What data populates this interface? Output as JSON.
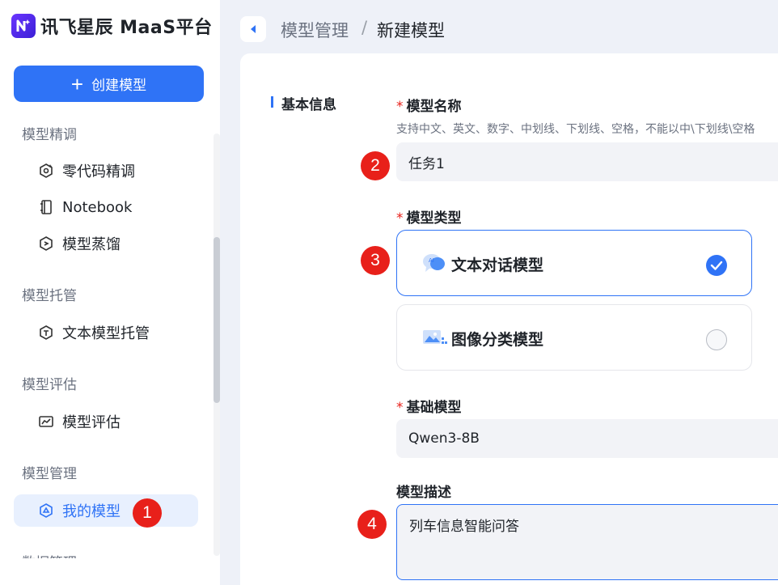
{
  "brand": {
    "name": "讯飞星辰 MaaS平台"
  },
  "sidebar": {
    "create_button": "创建模型",
    "partial_top_group": "模型精调",
    "partial_bottom_group": "数据管理",
    "groups": [
      {
        "label": "模型托管"
      },
      {
        "label": "模型评估"
      },
      {
        "label": "模型管理"
      }
    ],
    "items": [
      {
        "label": "零代码精调",
        "icon": "finetune-icon"
      },
      {
        "label": "Notebook",
        "icon": "notebook-icon"
      },
      {
        "label": "模型蒸馏",
        "icon": "distill-icon"
      },
      {
        "label": "文本模型托管",
        "icon": "hosting-icon"
      },
      {
        "label": "模型评估",
        "icon": "evaluate-icon"
      },
      {
        "label": "我的模型",
        "icon": "my-model-icon",
        "active": true
      }
    ]
  },
  "header": {
    "breadcrumb_parent": "模型管理",
    "separator": "/",
    "breadcrumb_current": "新建模型"
  },
  "form": {
    "section_title": "基本信息",
    "required_mark": "*",
    "name_label": "模型名称",
    "name_hint": "支持中文、英文、数字、中划线、下划线、空格，不能以中\\下划线\\空格",
    "name_value": "任务1",
    "type_label": "模型类型",
    "type_options": [
      {
        "label": "文本对话模型",
        "selected": true
      },
      {
        "label": "图像分类模型",
        "selected": false
      }
    ],
    "base_label": "基础模型",
    "base_value": "Qwen3-8B",
    "desc_label": "模型描述",
    "desc_value": "列车信息智能问答"
  },
  "annotations": [
    "1",
    "2",
    "3",
    "4"
  ],
  "colors": {
    "accent": "#2f73f6",
    "badge": "#e8201a",
    "brand_gradient": "#6a35ff"
  }
}
